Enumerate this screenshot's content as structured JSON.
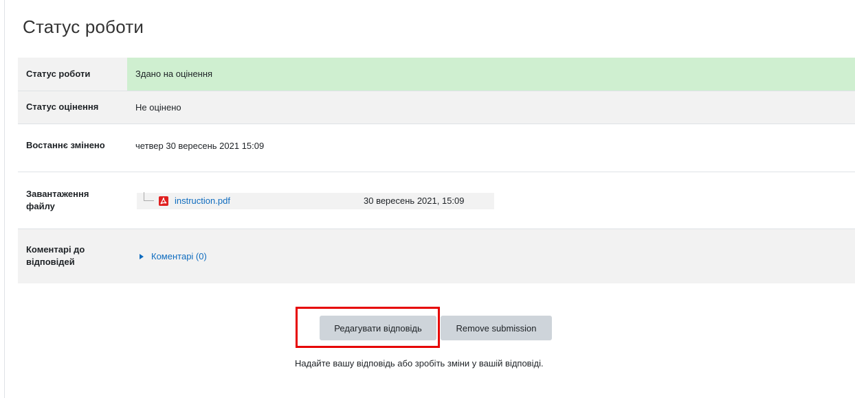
{
  "page": {
    "heading": "Статус роботи"
  },
  "status_table": {
    "rows": [
      {
        "label": "Статус роботи",
        "value": "Здано на оцінення"
      },
      {
        "label": "Статус оцінення",
        "value": "Не оцінено"
      },
      {
        "label": "Востаннє змінено",
        "value": "четвер 30 вересень 2021 15:09"
      },
      {
        "label": "Завантаження файлу"
      },
      {
        "label": "Коментарі до відповідей"
      }
    ],
    "file": {
      "name": "instruction.pdf",
      "date": "30 вересень 2021, 15:09",
      "icon": "pdf-icon"
    },
    "comments": {
      "label": "Коментарі (0)",
      "icon": "triangle-right-icon"
    }
  },
  "actions": {
    "edit_label": "Редагувати відповідь",
    "remove_label": "Remove submission",
    "hint": "Надайте вашу відповідь або зробіть зміни у вашій відповіді."
  },
  "colors": {
    "submitted_bg": "#cfefd0",
    "row_grey": "#f2f2f2",
    "link": "#0f6cbf",
    "highlight": "#e60000",
    "button_bg": "#ced4da"
  }
}
